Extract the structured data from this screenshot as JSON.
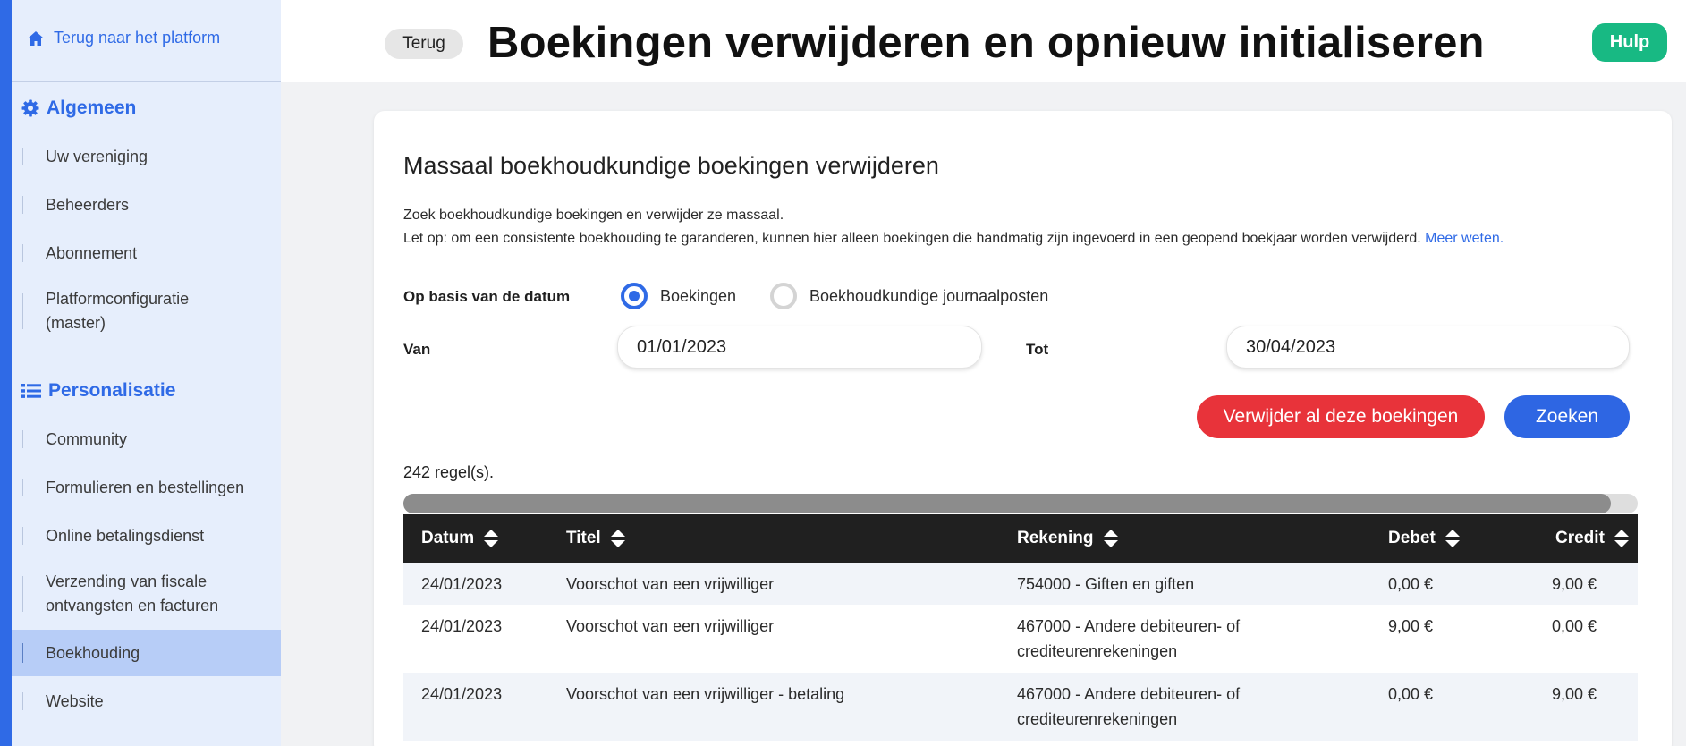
{
  "sidebar": {
    "back_link": "Terug naar het platform",
    "sections": [
      {
        "title": "Algemeen",
        "icon": "gear-icon",
        "items": [
          "Uw vereniging",
          "Beheerders",
          "Abonnement",
          "Platformconfiguratie (master)"
        ]
      },
      {
        "title": "Personalisatie",
        "icon": "list-icon",
        "items": [
          "Community",
          "Formulieren en bestellingen",
          "Online betalingsdienst",
          "Verzending van fiscale ontvangsten en facturen",
          "Boekhouding",
          "Website"
        ]
      }
    ],
    "active_item": "Boekhouding"
  },
  "header": {
    "back_label": "Terug",
    "title": "Boekingen verwijderen en opnieuw initialiseren",
    "help_label": "Hulp"
  },
  "card": {
    "title": "Massaal boekhoudkundige boekingen verwijderen",
    "desc_line1": "Zoek boekhoudkundige boekingen en verwijder ze massaal.",
    "desc_line2": "Let op: om een consistente boekhouding te garanderen, kunnen hier alleen boekingen die handmatig zijn ingevoerd in een geopend boekjaar worden verwijderd.",
    "learn_more": "Meer weten.",
    "date_basis_label": "Op basis van de datum",
    "radio_options": [
      "Boekingen",
      "Boekhoudkundige journaalposten"
    ],
    "radio_selected": "Boekingen",
    "from_label": "Van",
    "from_value": "01/01/2023",
    "to_label": "Tot",
    "to_value": "30/04/2023",
    "delete_button": "Verwijder al deze boekingen",
    "search_button": "Zoeken",
    "rows_count": "242 regel(s)."
  },
  "table": {
    "columns": [
      "Datum",
      "Titel",
      "Rekening",
      "Debet",
      "Credit"
    ],
    "rows": [
      {
        "datum": "24/01/2023",
        "titel": "Voorschot van een vrijwilliger",
        "rekening": "754000 - Giften en giften",
        "debet": "0,00 €",
        "credit": "9,00 €"
      },
      {
        "datum": "24/01/2023",
        "titel": "Voorschot van een vrijwilliger",
        "rekening": "467000 - Andere debiteuren- of crediteurenrekeningen",
        "debet": "9,00 €",
        "credit": "0,00 €"
      },
      {
        "datum": "24/01/2023",
        "titel": "Voorschot van een vrijwilliger - betaling",
        "rekening": "467000 - Andere debiteuren- of crediteurenrekeningen",
        "debet": "0,00 €",
        "credit": "9,00 €"
      }
    ]
  },
  "colors": {
    "accent": "#2f6ae6",
    "danger": "#e8333a",
    "success": "#18b983",
    "table_header": "#202020"
  }
}
